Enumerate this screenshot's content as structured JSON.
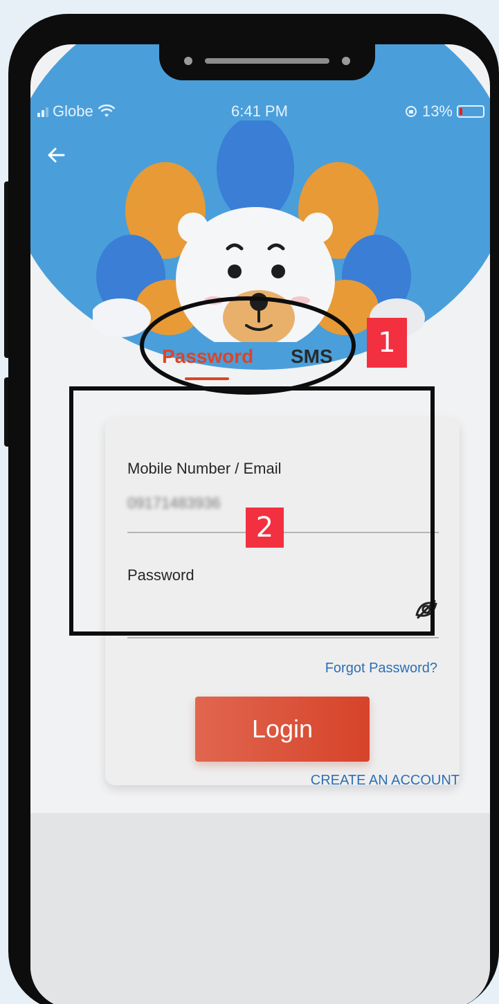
{
  "status_bar": {
    "carrier": "Globe",
    "time": "6:41 PM",
    "battery": "13%",
    "battery_level": 0.13
  },
  "tabs": {
    "password_label": "Password",
    "sms_label": "SMS",
    "active": "Password"
  },
  "login_form": {
    "mobile_label": "Mobile Number / Email",
    "mobile_value": "09171483936",
    "password_label": "Password",
    "password_value": "",
    "forgot_password": "Forgot Password?",
    "login_button": "Login"
  },
  "create_account": "CREATE AN ACCOUNT",
  "annotations": {
    "badge_1": "1",
    "badge_2": "2"
  },
  "colors": {
    "accent": "#de4326",
    "link": "#2d6fb3",
    "header_blue": "#4a9fdb",
    "badge_red": "#f23040"
  },
  "icons": {
    "back": "arrow-left-icon",
    "wifi": "wifi-icon",
    "password_visibility": "eye-off-icon"
  }
}
